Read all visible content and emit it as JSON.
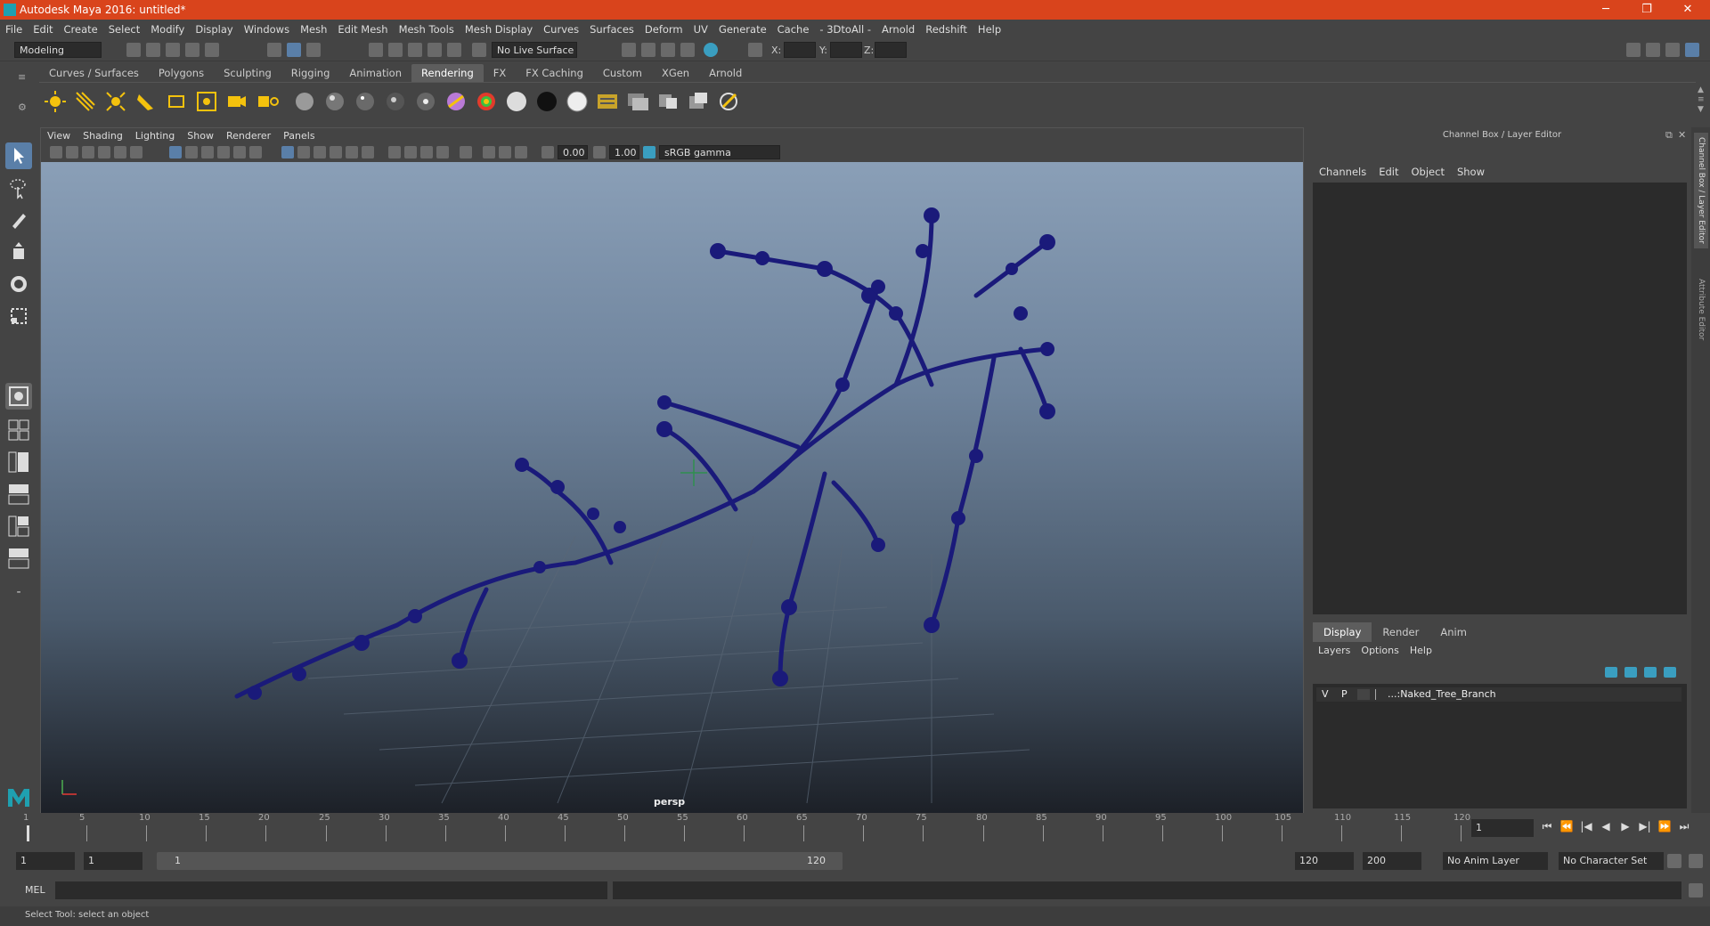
{
  "window": {
    "title": "Autodesk Maya 2016: untitled*",
    "controls": [
      "─",
      "❐",
      "✕"
    ]
  },
  "menu": [
    "File",
    "Edit",
    "Create",
    "Select",
    "Modify",
    "Display",
    "Windows",
    "Mesh",
    "Edit Mesh",
    "Mesh Tools",
    "Mesh Display",
    "Curves",
    "Surfaces",
    "Deform",
    "UV",
    "Generate",
    "Cache",
    "- 3DtoAll -",
    "Arnold",
    "Redshift",
    "Help"
  ],
  "toolbar": {
    "mode": "Modeling",
    "live_surface": "No Live Surface",
    "x_label": "X:",
    "y_label": "Y:",
    "z_label": "Z:"
  },
  "shelf": {
    "tabs": [
      "Curves / Surfaces",
      "Polygons",
      "Sculpting",
      "Rigging",
      "Animation",
      "Rendering",
      "FX",
      "FX Caching",
      "Custom",
      "XGen",
      "Arnold"
    ],
    "active_tab": "Rendering"
  },
  "viewport": {
    "menu": [
      "View",
      "Shading",
      "Lighting",
      "Show",
      "Renderer",
      "Panels"
    ],
    "exposure": "0.00",
    "gamma": "1.00",
    "color_space": "sRGB gamma",
    "camera_label": "persp",
    "object_color": "#1a1a7a",
    "sky_top": "#8a9fb7",
    "ground_bottom": "#1c2027"
  },
  "channel_box": {
    "header": "Channel Box / Layer Editor",
    "menu": [
      "Channels",
      "Edit",
      "Object",
      "Show"
    ]
  },
  "layer_editor": {
    "tabs": [
      "Display",
      "Render",
      "Anim"
    ],
    "active_tab": "Display",
    "menu": [
      "Layers",
      "Options",
      "Help"
    ],
    "layers": [
      {
        "v": "V",
        "p": "P",
        "name": "...:Naked_Tree_Branch"
      }
    ]
  },
  "side_tabs": [
    "Channel Box / Layer Editor",
    "Attribute Editor"
  ],
  "timeline": {
    "ticks": [
      "5",
      "10",
      "15",
      "20",
      "25",
      "30",
      "35",
      "40",
      "45",
      "50",
      "55",
      "60",
      "65",
      "70",
      "75",
      "80",
      "85",
      "90",
      "95",
      "100",
      "105",
      "110",
      "115",
      "120"
    ],
    "first_tick": "1",
    "current_frame": "1"
  },
  "range": {
    "start": "1",
    "playback_start": "1",
    "slider_start": "1",
    "slider_end": "120",
    "playback_end": "120",
    "end": "200",
    "anim_layer": "No Anim Layer",
    "character_set": "No Character Set"
  },
  "mel": {
    "label": "MEL"
  },
  "status": {
    "text": "Select Tool: select an object"
  }
}
